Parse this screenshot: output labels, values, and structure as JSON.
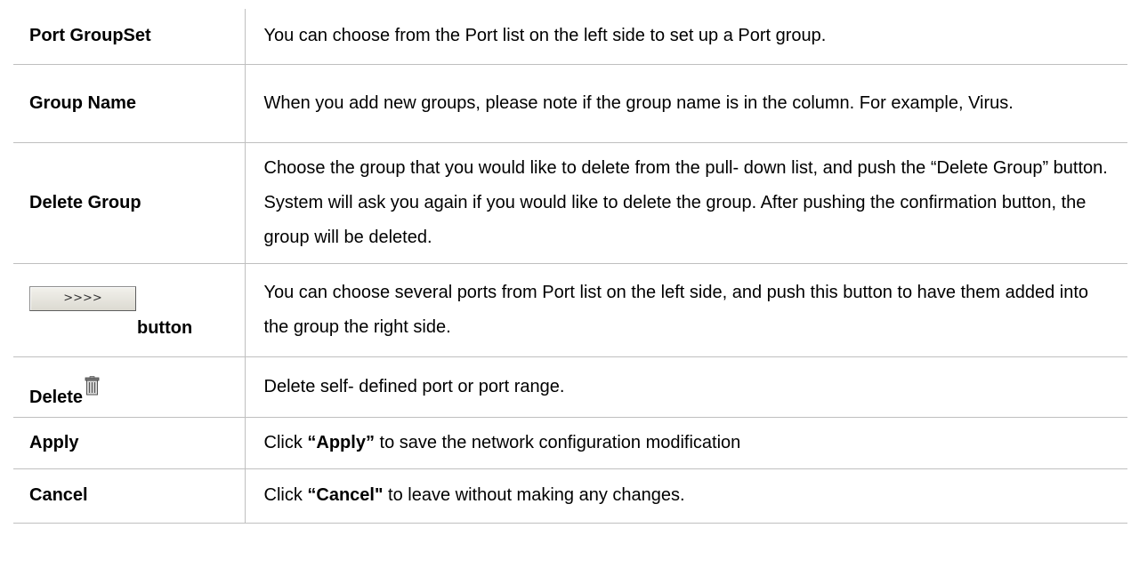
{
  "rows": [
    {
      "term": "Port GroupSet",
      "desc": "You can choose from the Port list on the left side to set up a Port group."
    },
    {
      "term": "Group Name",
      "desc": "When you add new groups, please note if the group name is in the column. For example, Virus."
    },
    {
      "term": "Delete Group",
      "desc": "Choose the group that you would like to delete from the pull- down list, and push the “Delete Group” button. System will ask you again if you would like to delete the group. After pushing the confirmation button, the group will be deleted."
    },
    {
      "button_label": ">>>>",
      "term": "button",
      "desc": "You can choose several ports from Port list on the left side, and push this button to have them added into the group the right side."
    },
    {
      "term": "Delete",
      "icon": "trash-icon",
      "desc": "Delete self- defined port or port range."
    },
    {
      "term": "Apply",
      "desc_pre": "Click ",
      "desc_bold": "“Apply”",
      "desc_post": " to save the network configuration modification"
    },
    {
      "term": "Cancel",
      "desc_pre": "Click ",
      "desc_bold": "“Cancel\"",
      "desc_post": " to leave without making any changes."
    }
  ]
}
